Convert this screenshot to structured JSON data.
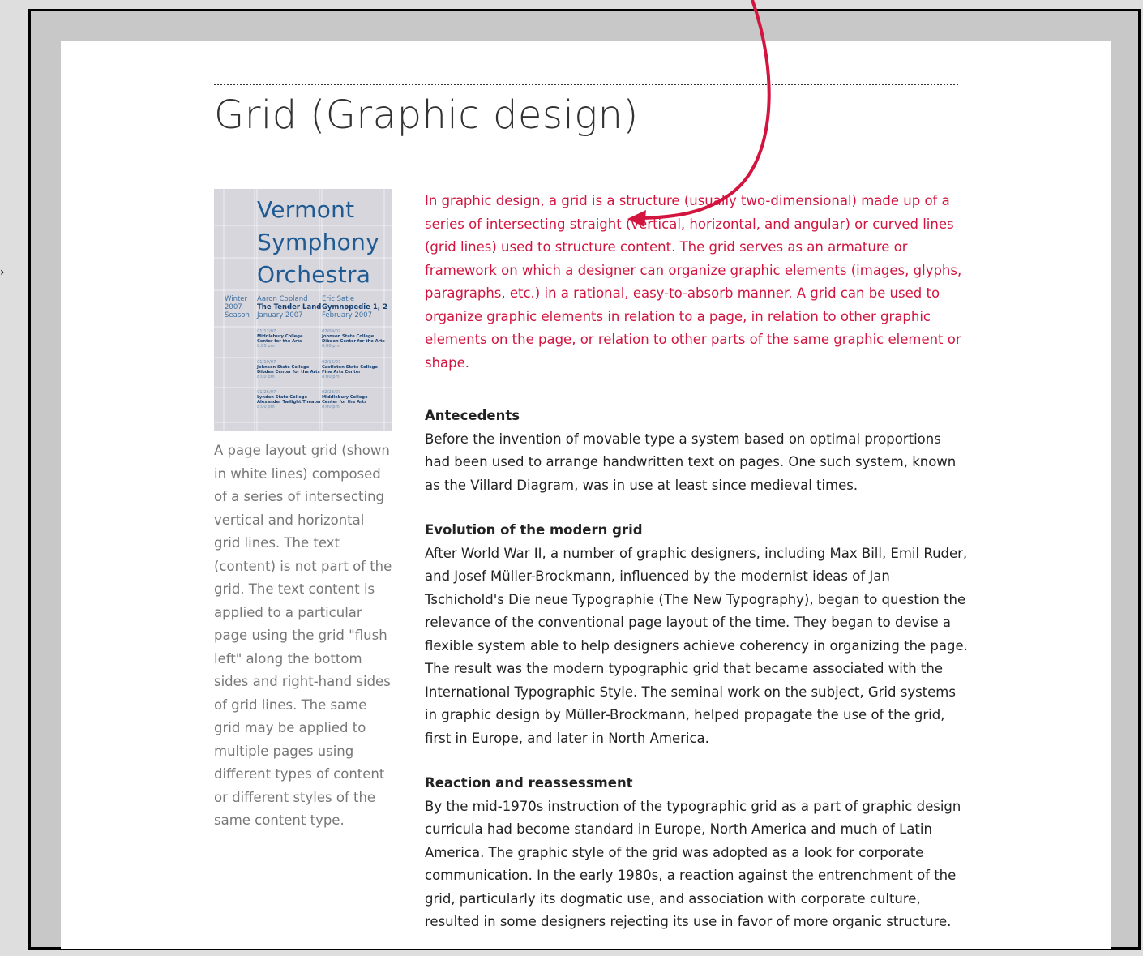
{
  "page": {
    "title": "Grid (Graphic design)"
  },
  "figure": {
    "poster": {
      "title_lines": [
        "Vermont",
        "Symphony",
        "Orchestra"
      ],
      "season": [
        "Winter",
        "2007",
        "Season"
      ],
      "left_column": {
        "name": "Aaron Copland",
        "work": "The Tender Land",
        "date": "January 2007"
      },
      "right_column": {
        "name": "Eric Satie",
        "work": "Gymnopedie 1, 2",
        "date": "February 2007"
      },
      "events_left": [
        {
          "date": "01/12/07",
          "venue1": "Middlebury College",
          "venue2": "Center for the Arts",
          "time": "8:00 pm"
        },
        {
          "date": "01/19/07",
          "venue1": "Johnson State College",
          "venue2": "Dibden Center for the Arts",
          "time": "8:00 pm"
        },
        {
          "date": "01/26/07",
          "venue1": "Lyndon State College",
          "venue2": "Alexander Twilight Theater",
          "time": "8:00 pm"
        }
      ],
      "events_right": [
        {
          "date": "02/09/07",
          "venue1": "Johnson State College",
          "venue2": "Dibden Center for the Arts",
          "time": "8:00 pm"
        },
        {
          "date": "02/16/07",
          "venue1": "Castleton State College",
          "venue2": "Fine Arts Center",
          "time": "8:00 pm"
        },
        {
          "date": "02/23/07",
          "venue1": "Middlebury College",
          "venue2": "Center for the Arts",
          "time": "8:00 pm"
        }
      ],
      "colors": {
        "background": "#d6d6dc",
        "title": "#1f5a92"
      }
    },
    "caption": "A page layout grid (shown in white lines) composed of a series of intersecting vertical and horizontal grid lines. The text (content) is not part of the grid. The text content is applied to a particular page using the grid \"flush left\" along the bottom sides and right-hand sides of grid lines. The same grid may be applied to multiple pages using different types of content or different styles of the same content type."
  },
  "article": {
    "intro": "In graphic design, a grid is a structure (usually two-dimensional) made up of a series of intersecting straight (vertical, horizontal, and angular) or curved lines (grid lines) used to structure content. The grid serves as an armature or framework on which a designer can organize graphic elements (images, glyphs, paragraphs, etc.) in a rational, easy-to-absorb manner. A grid can be used to organize graphic elements in relation to a page, in relation to other graphic elements on the page, or relation to other parts of the same graphic element or shape.",
    "sections": [
      {
        "heading": "Antecedents",
        "body": "Before the invention of movable type a system based on optimal proportions had been used to arrange handwritten text on pages. One such system, known as the Villard Diagram, was in use at least since medieval times."
      },
      {
        "heading": "Evolution of the modern grid",
        "body": "After World War II, a number of graphic designers, including Max Bill, Emil Ruder, and Josef Müller-Brockmann, influenced by the modernist ideas of Jan Tschichold's Die neue Typographie (The New Typography), began to question the relevance of the conventional page layout of the time. They began to devise a flexible system able to help designers achieve coherency in organizing the page. The result was the modern typographic grid that became associated with the International Typographic Style. The seminal work on the subject, Grid systems in graphic design by Müller-Brockmann, helped propagate the use of the grid, first in Europe, and later in North America."
      },
      {
        "heading": "Reaction and reassessment",
        "body": "By the mid-1970s instruction of the typographic grid as a part of graphic design curricula had become standard in Europe, North America and much of Latin America. The graphic style of the grid was adopted as a look for corporate communication. In the early 1980s, a reaction against the entrenchment of the grid, particularly its dogmatic use, and association with corporate culture, resulted in some designers rejecting its use in favor of more organic structure."
      }
    ]
  },
  "colors": {
    "intro_text": "#d2143f",
    "annotation_arrow": "#d2143f",
    "frame_background": "#c8c8c8",
    "outer_background": "#dedede"
  }
}
